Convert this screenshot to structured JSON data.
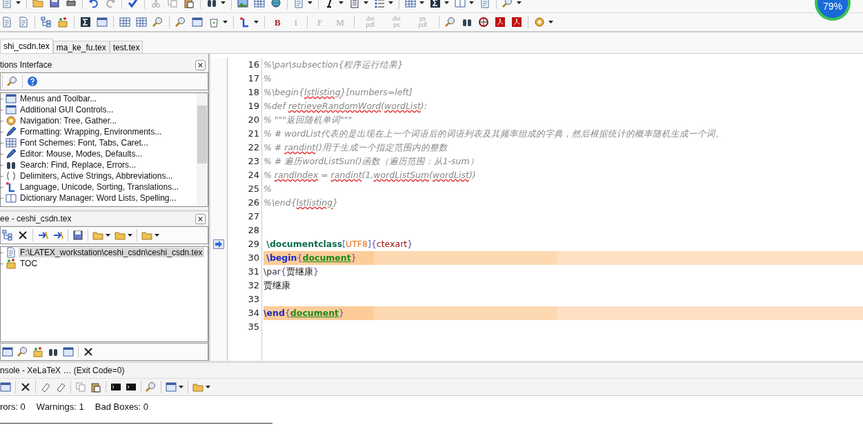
{
  "toolbar_top": {
    "format_buttons": [
      {
        "label": "B",
        "disabled": false
      },
      {
        "label": "I",
        "disabled": true
      },
      {
        "label": "F",
        "disabled": true
      },
      {
        "label": "M",
        "disabled": true
      },
      {
        "label": "dvi pdf",
        "disabled": true
      },
      {
        "label": "dvi ps",
        "disabled": true
      },
      {
        "label": "ps pdf",
        "disabled": true
      }
    ]
  },
  "meter": {
    "reading": "79%",
    "level": 0.79
  },
  "tabs": [
    {
      "label": "shi_csdn.tex",
      "selected": true
    },
    {
      "label": "ma_ke_fu.tex",
      "selected": false
    },
    {
      "label": "test.tex",
      "selected": false
    }
  ],
  "options_panel": {
    "title": "tions Interface",
    "items": [
      {
        "label": "Menus and Toolbar..."
      },
      {
        "label": "Additional GUI Controls..."
      },
      {
        "label": "Navigation: Tree, Gather..."
      },
      {
        "label": "Formatting: Wrapping, Environments..."
      },
      {
        "label": "Font Schemes: Font, Tabs, Caret..."
      },
      {
        "label": "Editor: Mouse, Modes, Defaults..."
      },
      {
        "label": "Search: Find, Replace, Errors..."
      },
      {
        "label": "Delimiters, Active Strings, Abbreviations..."
      },
      {
        "label": "Language, Unicode, Sorting, Translations..."
      },
      {
        "label": "Dictionary Manager: Word Lists, Spelling..."
      }
    ]
  },
  "tree_panel": {
    "title": "ee - ceshi_csdn.tex",
    "items": [
      {
        "label": "F:\\LATEX_workstation\\ceshi_csdn\\ceshi_csdn.tex",
        "selected": true
      },
      {
        "label": "TOC",
        "selected": false
      }
    ]
  },
  "editor": {
    "lines": [
      {
        "number": "16",
        "highlighted": false,
        "marker": false,
        "tokens": [
          {
            "kind": "comment",
            "text": "%\\par\\subsection{程序运行结果}"
          }
        ]
      },
      {
        "number": "17",
        "highlighted": false,
        "marker": false,
        "tokens": [
          {
            "kind": "comment",
            "text": "%"
          }
        ]
      },
      {
        "number": "18",
        "highlighted": false,
        "marker": false,
        "tokens": [
          {
            "kind": "comment",
            "text": "%\\begin{"
          },
          {
            "kind": "misspelled",
            "text": "lstlisting"
          },
          {
            "kind": "comment",
            "text": "}[numbers=left]"
          }
        ]
      },
      {
        "number": "19",
        "highlighted": false,
        "marker": false,
        "tokens": [
          {
            "kind": "comment",
            "text": "%def "
          },
          {
            "kind": "misspelled",
            "text": "retrieveRandomWord"
          },
          {
            "kind": "comment",
            "text": "("
          },
          {
            "kind": "misspelled",
            "text": "wordList"
          },
          {
            "kind": "comment",
            "text": "):"
          }
        ]
      },
      {
        "number": "20",
        "highlighted": false,
        "marker": false,
        "tokens": [
          {
            "kind": "comment",
            "text": "% \"\"\"返回随机单词\"\"\""
          }
        ]
      },
      {
        "number": "21",
        "highlighted": false,
        "marker": false,
        "tokens": [
          {
            "kind": "comment",
            "text": "% # wordList代表的是出现在上一个词语后的词语列表及其频率组成的字典，然后根据统计的概率随机生成一个词。"
          }
        ]
      },
      {
        "number": "22",
        "highlighted": false,
        "marker": false,
        "tokens": [
          {
            "kind": "comment",
            "text": "% # "
          },
          {
            "kind": "misspelled",
            "text": "randint"
          },
          {
            "kind": "comment",
            "text": "()用于生成一个指定范围内的整数"
          }
        ]
      },
      {
        "number": "23",
        "highlighted": false,
        "marker": false,
        "tokens": [
          {
            "kind": "comment",
            "text": "% # 遍历wordListSun()函数（遍历范围：从1-sum）"
          }
        ]
      },
      {
        "number": "24",
        "highlighted": false,
        "marker": false,
        "tokens": [
          {
            "kind": "comment",
            "text": "% "
          },
          {
            "kind": "misspelled",
            "text": "randIndex"
          },
          {
            "kind": "comment",
            "text": " = "
          },
          {
            "kind": "misspelled",
            "text": "randint"
          },
          {
            "kind": "comment",
            "text": "(1,"
          },
          {
            "kind": "misspelled",
            "text": "wordListSum"
          },
          {
            "kind": "comment",
            "text": "("
          },
          {
            "kind": "misspelled",
            "text": "wordList"
          },
          {
            "kind": "comment",
            "text": "))"
          }
        ]
      },
      {
        "number": "25",
        "highlighted": false,
        "marker": false,
        "tokens": [
          {
            "kind": "comment",
            "text": "%"
          }
        ]
      },
      {
        "number": "26",
        "highlighted": false,
        "marker": false,
        "tokens": [
          {
            "kind": "comment",
            "text": "%\\end{"
          },
          {
            "kind": "misspelled",
            "text": "lstlisting"
          },
          {
            "kind": "comment",
            "text": "}"
          }
        ]
      },
      {
        "number": "27",
        "marker": false
      },
      {
        "number": "28",
        "marker": false
      },
      {
        "number": "29",
        "highlighted": false,
        "marker": true,
        "tokens": [
          {
            "kind": "command",
            "text": " \\documentclass"
          },
          {
            "kind": "bracket",
            "text": "["
          },
          {
            "kind": "option",
            "text": "UTF8"
          },
          {
            "kind": "bracket",
            "text": "]"
          },
          {
            "kind": "brace",
            "text": "{"
          },
          {
            "kind": "argument",
            "text": "ctexart"
          },
          {
            "kind": "brace",
            "text": "}"
          }
        ]
      },
      {
        "number": "30",
        "highlighted": true,
        "marker": false,
        "tokens": [
          {
            "kind": "keyword",
            "text": " \\begin"
          },
          {
            "kind": "brace",
            "text": "{"
          },
          {
            "kind": "environment",
            "text": "document"
          },
          {
            "kind": "brace",
            "text": "}"
          }
        ]
      },
      {
        "number": "31",
        "highlighted": false,
        "marker": false,
        "tokens": [
          {
            "kind": "macro",
            "text": "\\par"
          },
          {
            "kind": "brace",
            "text": "{"
          },
          {
            "kind": "text",
            "text": "贾继康"
          },
          {
            "kind": "brace",
            "text": "}"
          }
        ]
      },
      {
        "number": "32",
        "highlighted": false,
        "marker": false,
        "tokens": [
          {
            "kind": "text",
            "text": "贾继康"
          }
        ]
      },
      {
        "number": "33",
        "marker": false
      },
      {
        "number": "34",
        "highlighted": true,
        "marker": false,
        "tokens": [
          {
            "kind": "keyword",
            "text": "\\end"
          },
          {
            "kind": "brace",
            "text": "{"
          },
          {
            "kind": "environment",
            "text": "document"
          },
          {
            "kind": "brace",
            "text": "}"
          }
        ]
      },
      {
        "number": "35",
        "marker": false
      }
    ]
  },
  "console": {
    "title": "nsole - XeLaTeX … (Exit Code=0)",
    "status": [
      "rors: 0",
      "Warnings: 1",
      "Bad Boxes: 0"
    ]
  }
}
